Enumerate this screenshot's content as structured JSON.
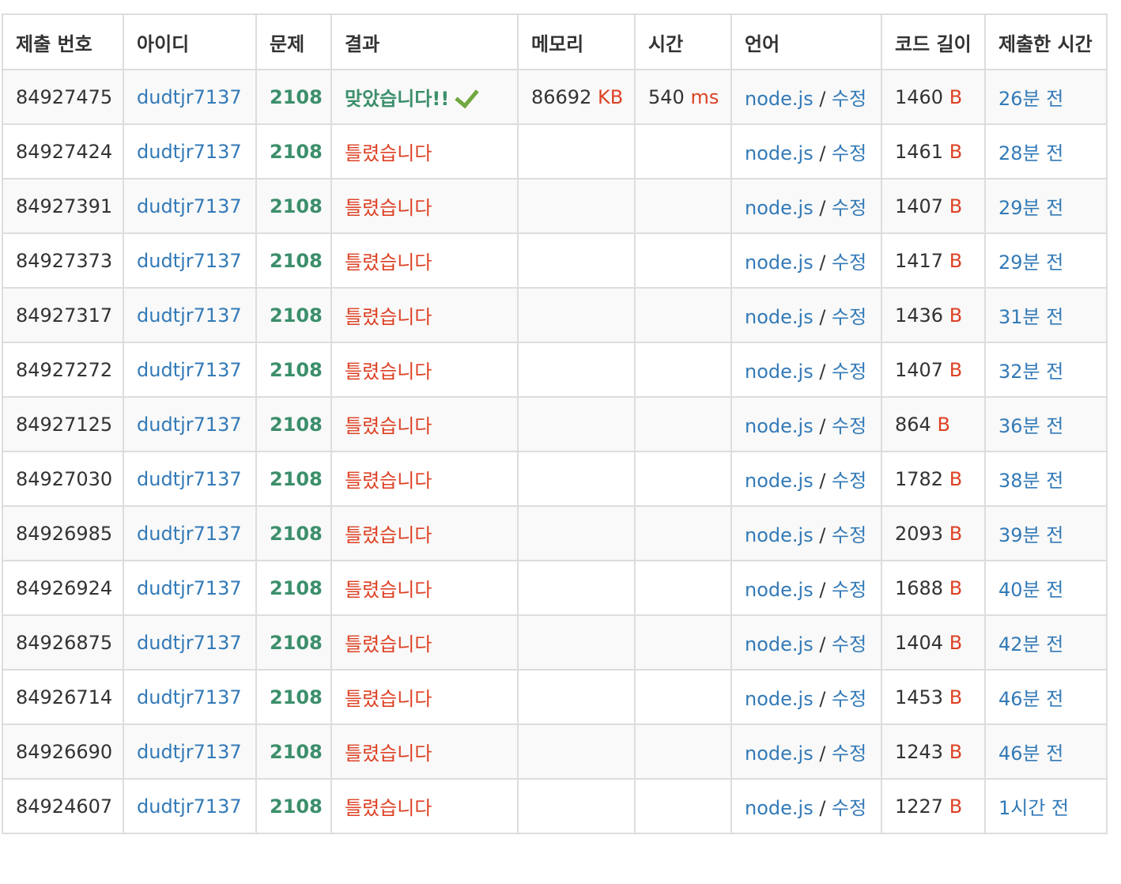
{
  "colors": {
    "link": "#337ab7",
    "accepted": "#3c8f6b",
    "wrong": "#dd4124",
    "check": "#6fa83f"
  },
  "headers": [
    "제출 번호",
    "아이디",
    "문제",
    "결과",
    "메모리",
    "시간",
    "언어",
    "코드 길이",
    "제출한 시간"
  ],
  "edit_label": "수정",
  "rows": [
    {
      "id": "84927475",
      "user": "dudtjr7137",
      "problem": "2108",
      "result": "맞았습니다!!",
      "accepted": true,
      "memory": "86692",
      "memory_unit": "KB",
      "time": "540",
      "time_unit": "ms",
      "lang": "node.js",
      "length": "1460",
      "length_unit": "B",
      "submitted": "26분 전",
      "result_icon": "check-icon"
    },
    {
      "id": "84927424",
      "user": "dudtjr7137",
      "problem": "2108",
      "result": "틀렸습니다",
      "accepted": false,
      "memory": "",
      "time": "",
      "lang": "node.js",
      "length": "1461",
      "length_unit": "B",
      "submitted": "28분 전"
    },
    {
      "id": "84927391",
      "user": "dudtjr7137",
      "problem": "2108",
      "result": "틀렸습니다",
      "accepted": false,
      "memory": "",
      "time": "",
      "lang": "node.js",
      "length": "1407",
      "length_unit": "B",
      "submitted": "29분 전"
    },
    {
      "id": "84927373",
      "user": "dudtjr7137",
      "problem": "2108",
      "result": "틀렸습니다",
      "accepted": false,
      "memory": "",
      "time": "",
      "lang": "node.js",
      "length": "1417",
      "length_unit": "B",
      "submitted": "29분 전"
    },
    {
      "id": "84927317",
      "user": "dudtjr7137",
      "problem": "2108",
      "result": "틀렸습니다",
      "accepted": false,
      "memory": "",
      "time": "",
      "lang": "node.js",
      "length": "1436",
      "length_unit": "B",
      "submitted": "31분 전"
    },
    {
      "id": "84927272",
      "user": "dudtjr7137",
      "problem": "2108",
      "result": "틀렸습니다",
      "accepted": false,
      "memory": "",
      "time": "",
      "lang": "node.js",
      "length": "1407",
      "length_unit": "B",
      "submitted": "32분 전"
    },
    {
      "id": "84927125",
      "user": "dudtjr7137",
      "problem": "2108",
      "result": "틀렸습니다",
      "accepted": false,
      "memory": "",
      "time": "",
      "lang": "node.js",
      "length": "864",
      "length_unit": "B",
      "submitted": "36분 전"
    },
    {
      "id": "84927030",
      "user": "dudtjr7137",
      "problem": "2108",
      "result": "틀렸습니다",
      "accepted": false,
      "memory": "",
      "time": "",
      "lang": "node.js",
      "length": "1782",
      "length_unit": "B",
      "submitted": "38분 전"
    },
    {
      "id": "84926985",
      "user": "dudtjr7137",
      "problem": "2108",
      "result": "틀렸습니다",
      "accepted": false,
      "memory": "",
      "time": "",
      "lang": "node.js",
      "length": "2093",
      "length_unit": "B",
      "submitted": "39분 전"
    },
    {
      "id": "84926924",
      "user": "dudtjr7137",
      "problem": "2108",
      "result": "틀렸습니다",
      "accepted": false,
      "memory": "",
      "time": "",
      "lang": "node.js",
      "length": "1688",
      "length_unit": "B",
      "submitted": "40분 전"
    },
    {
      "id": "84926875",
      "user": "dudtjr7137",
      "problem": "2108",
      "result": "틀렸습니다",
      "accepted": false,
      "memory": "",
      "time": "",
      "lang": "node.js",
      "length": "1404",
      "length_unit": "B",
      "submitted": "42분 전"
    },
    {
      "id": "84926714",
      "user": "dudtjr7137",
      "problem": "2108",
      "result": "틀렸습니다",
      "accepted": false,
      "memory": "",
      "time": "",
      "lang": "node.js",
      "length": "1453",
      "length_unit": "B",
      "submitted": "46분 전"
    },
    {
      "id": "84926690",
      "user": "dudtjr7137",
      "problem": "2108",
      "result": "틀렸습니다",
      "accepted": false,
      "memory": "",
      "time": "",
      "lang": "node.js",
      "length": "1243",
      "length_unit": "B",
      "submitted": "46분 전"
    },
    {
      "id": "84924607",
      "user": "dudtjr7137",
      "problem": "2108",
      "result": "틀렸습니다",
      "accepted": false,
      "memory": "",
      "time": "",
      "lang": "node.js",
      "length": "1227",
      "length_unit": "B",
      "submitted": "1시간 전"
    }
  ]
}
